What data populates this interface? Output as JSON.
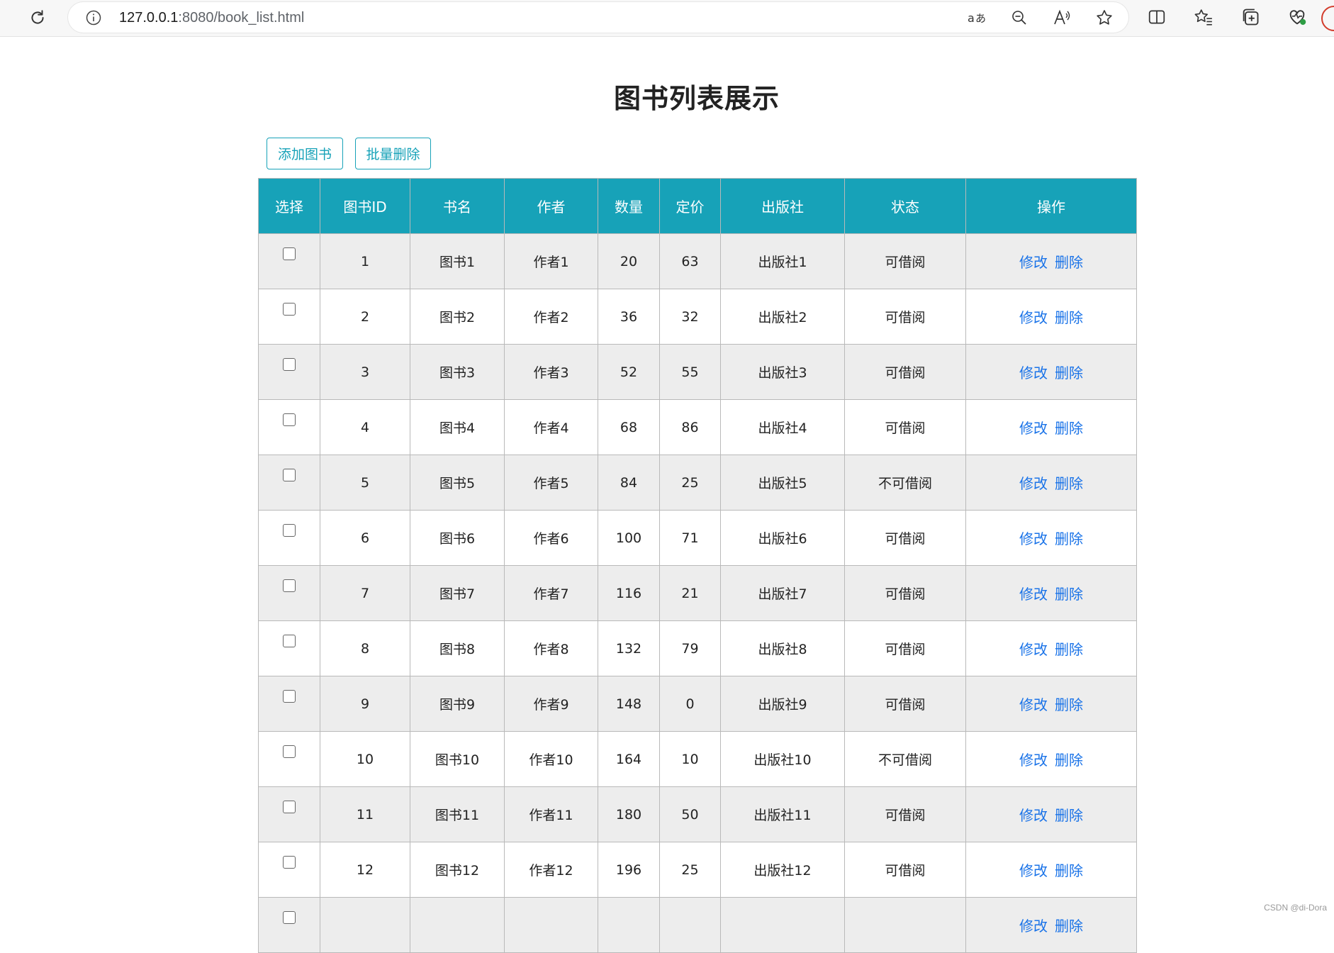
{
  "browser": {
    "url_host": "127.0.0.1",
    "url_path": ":8080/book_list.html"
  },
  "page": {
    "title": "图书列表展示",
    "add_button": "添加图书",
    "batch_delete_button": "批量删除"
  },
  "table": {
    "columns": [
      "选择",
      "图书ID",
      "书名",
      "作者",
      "数量",
      "定价",
      "出版社",
      "状态",
      "操作"
    ],
    "edit_label": "修改",
    "delete_label": "删除",
    "rows": [
      {
        "id": "1",
        "name": "图书1",
        "author": "作者1",
        "count": "20",
        "price": "63",
        "publisher": "出版社1",
        "status": "可借阅"
      },
      {
        "id": "2",
        "name": "图书2",
        "author": "作者2",
        "count": "36",
        "price": "32",
        "publisher": "出版社2",
        "status": "可借阅"
      },
      {
        "id": "3",
        "name": "图书3",
        "author": "作者3",
        "count": "52",
        "price": "55",
        "publisher": "出版社3",
        "status": "可借阅"
      },
      {
        "id": "4",
        "name": "图书4",
        "author": "作者4",
        "count": "68",
        "price": "86",
        "publisher": "出版社4",
        "status": "可借阅"
      },
      {
        "id": "5",
        "name": "图书5",
        "author": "作者5",
        "count": "84",
        "price": "25",
        "publisher": "出版社5",
        "status": "不可借阅"
      },
      {
        "id": "6",
        "name": "图书6",
        "author": "作者6",
        "count": "100",
        "price": "71",
        "publisher": "出版社6",
        "status": "可借阅"
      },
      {
        "id": "7",
        "name": "图书7",
        "author": "作者7",
        "count": "116",
        "price": "21",
        "publisher": "出版社7",
        "status": "可借阅"
      },
      {
        "id": "8",
        "name": "图书8",
        "author": "作者8",
        "count": "132",
        "price": "79",
        "publisher": "出版社8",
        "status": "可借阅"
      },
      {
        "id": "9",
        "name": "图书9",
        "author": "作者9",
        "count": "148",
        "price": "0",
        "publisher": "出版社9",
        "status": "可借阅"
      },
      {
        "id": "10",
        "name": "图书10",
        "author": "作者10",
        "count": "164",
        "price": "10",
        "publisher": "出版社10",
        "status": "不可借阅"
      },
      {
        "id": "11",
        "name": "图书11",
        "author": "作者11",
        "count": "180",
        "price": "50",
        "publisher": "出版社11",
        "status": "可借阅"
      },
      {
        "id": "12",
        "name": "图书12",
        "author": "作者12",
        "count": "196",
        "price": "25",
        "publisher": "出版社12",
        "status": "可借阅"
      },
      {
        "id": "",
        "name": "",
        "author": "",
        "count": "",
        "price": "",
        "publisher": "",
        "status": ""
      }
    ]
  },
  "watermark": "CSDN @di-Dora"
}
